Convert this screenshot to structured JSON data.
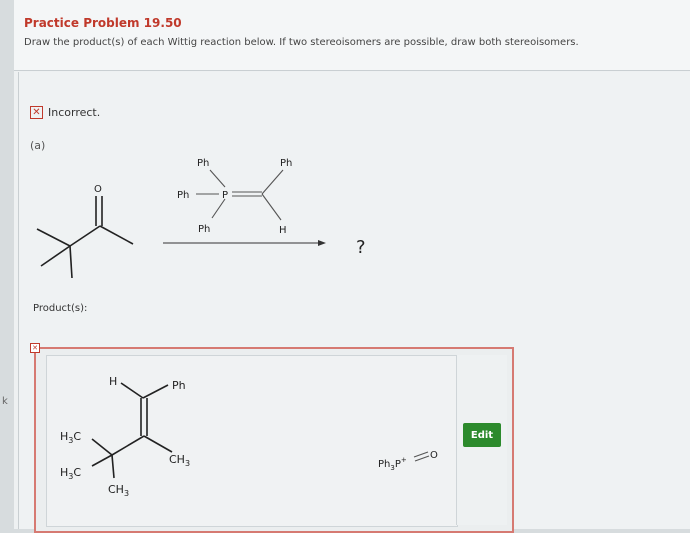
{
  "header": {
    "title": "Practice Problem 19.50",
    "instructions": "Draw the product(s) of each Wittig reaction below. If two stereoisomers are possible, draw both stereoisomers."
  },
  "status": {
    "text": "Incorrect."
  },
  "part_label": "(a)",
  "reaction": {
    "ketone_o": "O",
    "ylide": {
      "ph_top_left": "Ph",
      "ph_top_right": "Ph",
      "ph_left": "Ph",
      "p": "P",
      "ph_bottom": "Ph",
      "h": "H"
    },
    "question": "?"
  },
  "products_label": "Product(s):",
  "answer": {
    "h": "H",
    "ph": "Ph",
    "h3c_top": "H",
    "h3c_top_sub": "3",
    "h3c_top_c": "C",
    "h3c_bottom": "H",
    "h3c_bottom_sub": "3",
    "h3c_bottom_c": "C",
    "ch3_right": "CH",
    "ch3_right_sub": "3",
    "ch3_bottom": "CH",
    "ch3_bottom_sub": "3",
    "byproduct_ph": "Ph",
    "byproduct_sub": "3",
    "byproduct_p": "P",
    "byproduct_charge": "+",
    "byproduct_o": "O"
  },
  "edit_label": "Edit",
  "left_mark": "k"
}
